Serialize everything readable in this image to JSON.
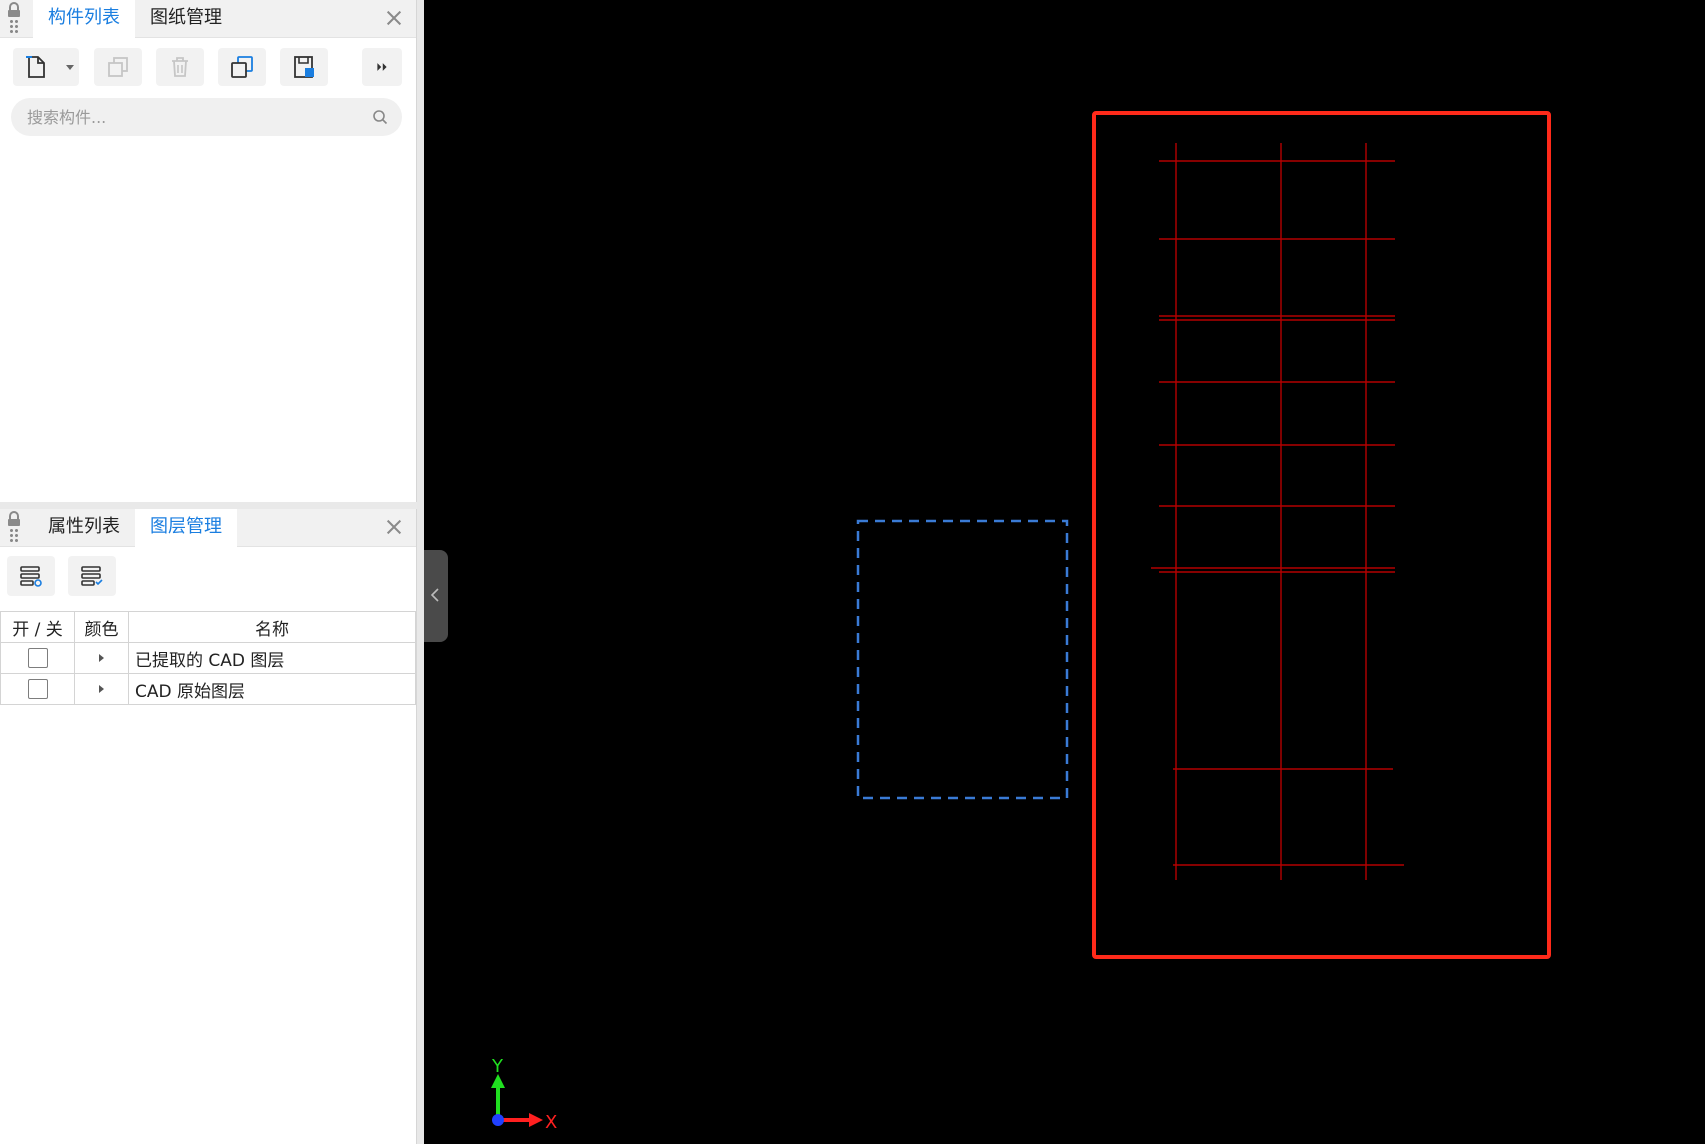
{
  "top_panel": {
    "tabs": [
      {
        "label": "构件列表",
        "active": true
      },
      {
        "label": "图纸管理",
        "active": false
      }
    ],
    "toolbar": {
      "new_icon": "new-file-icon",
      "copy_icon": "copy-icon",
      "delete_icon": "trash-icon",
      "duplicate_icon": "duplicate-icon",
      "save_icon": "save-layer-icon",
      "more_icon": "double-chevron-right-icon"
    },
    "search": {
      "placeholder": "搜索构件...",
      "value": ""
    }
  },
  "bottom_panel": {
    "tabs": [
      {
        "label": "属性列表",
        "active": false
      },
      {
        "label": "图层管理",
        "active": true
      }
    ],
    "toolbar": {
      "btn1_icon": "layer-show-icon",
      "btn2_icon": "layer-settings-icon"
    },
    "table": {
      "headers": [
        "开 / 关",
        "颜色",
        "名称"
      ],
      "rows": [
        {
          "checked": false,
          "name": "已提取的 CAD 图层"
        },
        {
          "checked": false,
          "name": "CAD 原始图层"
        }
      ]
    }
  },
  "canvas": {
    "background": "#000000",
    "selection_color": "#ff2a1a",
    "grid_color": "#b30000",
    "dashed_color": "#3a7bd5",
    "axis": {
      "x_label": "X",
      "y_label": "Y",
      "x_color": "#ff2020",
      "y_color": "#20e020",
      "origin_color": "#2040ff"
    }
  }
}
